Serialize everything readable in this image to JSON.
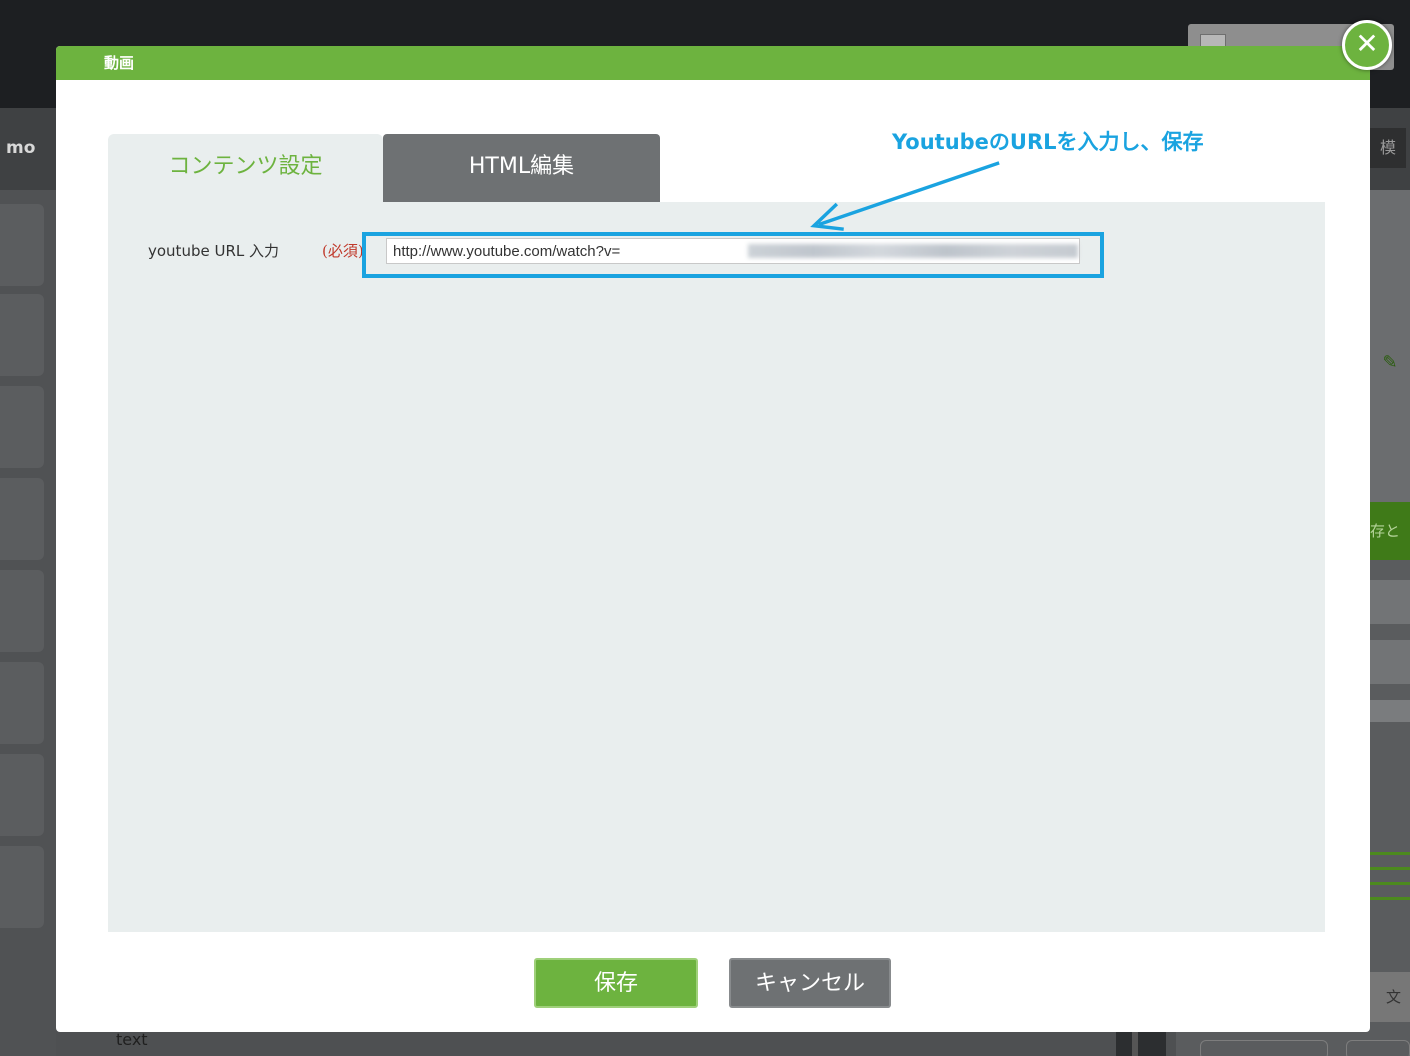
{
  "background": {
    "brand_partial": "mo",
    "user_partial": "",
    "right_button_partial": "模",
    "green_button_partial": "存と",
    "text_button_partial": "文",
    "bottom_text": "text"
  },
  "modal": {
    "title": "動画",
    "close_icon": "close-icon",
    "tabs": [
      {
        "label": "コンテンツ設定",
        "active": true
      },
      {
        "label": "HTML編集",
        "active": false
      }
    ],
    "form": {
      "url_label": "youtube URL 入力",
      "required_label": "(必須)",
      "url_value": "http://www.youtube.com/watch?v="
    },
    "buttons": {
      "save": "保存",
      "cancel": "キャンセル"
    }
  },
  "annotation": {
    "text": "YoutubeのURLを入力し、保存",
    "color": "#1aa3e0"
  },
  "colors": {
    "accent_green": "#6db33f",
    "tab_gray": "#6e7173",
    "panel_bg": "#e9eeee"
  }
}
